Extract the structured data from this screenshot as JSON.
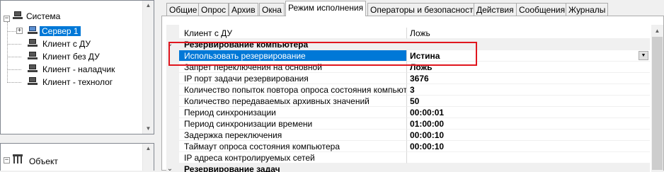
{
  "tree": {
    "root_label": "Система",
    "nodes": [
      {
        "label": "Сервер 1",
        "selected": true
      },
      {
        "label": "Клиент с ДУ"
      },
      {
        "label": "Клиент без ДУ"
      },
      {
        "label": "Клиент - наладчик"
      },
      {
        "label": "Клиент - технолог"
      }
    ],
    "bottom_root_label": "Объект"
  },
  "tabs": [
    "Общие",
    "Опрос",
    "Архив",
    "Окна",
    "Режим исполнения",
    "Операторы и безопасность",
    "Действия",
    "Сообщения",
    "Журналы"
  ],
  "active_tab": "Режим исполнения",
  "grid": {
    "rows": [
      {
        "kind": "prop",
        "key": "Клиент с ДУ",
        "value": "Ложь",
        "bold": false
      },
      {
        "kind": "cat",
        "key": "Резервирование компьютера",
        "toggle": "⌄"
      },
      {
        "kind": "prop",
        "key": "Использовать резервирование",
        "value": "Истина",
        "selected": true
      },
      {
        "kind": "prop",
        "key": "Запрет переключения на основной",
        "value": "Ложь"
      },
      {
        "kind": "prop",
        "key": "IP порт задачи резервирования",
        "value": "3676"
      },
      {
        "kind": "prop",
        "key": "Количество попыток повтора опроса состояния компьютера",
        "value": "3"
      },
      {
        "kind": "prop",
        "key": "Количество передаваемых архивных значений",
        "value": "50"
      },
      {
        "kind": "prop",
        "key": "Период синхронизации",
        "value": "00:00:01"
      },
      {
        "kind": "prop",
        "key": "Период синхронизации времени",
        "value": "01:00:00"
      },
      {
        "kind": "prop",
        "key": "Задержка переключения",
        "value": "00:00:10"
      },
      {
        "kind": "prop",
        "key": "Таймаут опроса состояния компьютера",
        "value": "00:00:10"
      },
      {
        "kind": "prop",
        "key": "IP адреса контролируемых сетей",
        "value": ""
      },
      {
        "kind": "cat",
        "key": "Резервирование задач",
        "toggle": "⌄"
      }
    ]
  },
  "colors": {
    "selection": "#0078d7",
    "highlight": "#e0161e"
  }
}
